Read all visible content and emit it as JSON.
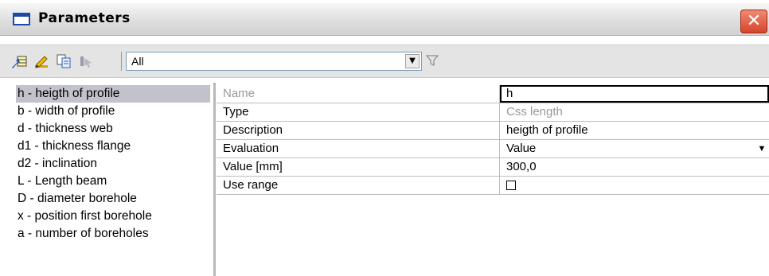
{
  "window": {
    "title": "Parameters",
    "close_glyph": "✕"
  },
  "toolbar": {
    "icons": [
      "arrow-into-table-icon",
      "pencil-edit-icon",
      "copy-table-icon",
      "cursor-disabled-icon"
    ],
    "filter": {
      "selected": "All"
    },
    "funnel_icon": "funnel-filter-icon"
  },
  "parameter_list": {
    "items": [
      "h - heigth of profile",
      "b - width of profile",
      "d - thickness web",
      "d1 - thickness flange",
      "d2 - inclination",
      "L - Length beam",
      "D - diameter borehole",
      "x - position first borehole",
      "a - number of boreholes"
    ],
    "selected_index": 0
  },
  "properties": {
    "rows": [
      {
        "label": "Name",
        "value": "h"
      },
      {
        "label": "Type",
        "value": "Css length"
      },
      {
        "label": "Description",
        "value": "heigth of profile"
      },
      {
        "label": "Evaluation",
        "value": "Value"
      },
      {
        "label": "Value [mm]",
        "value": "300,0"
      },
      {
        "label": "Use range",
        "value": ""
      }
    ]
  }
}
